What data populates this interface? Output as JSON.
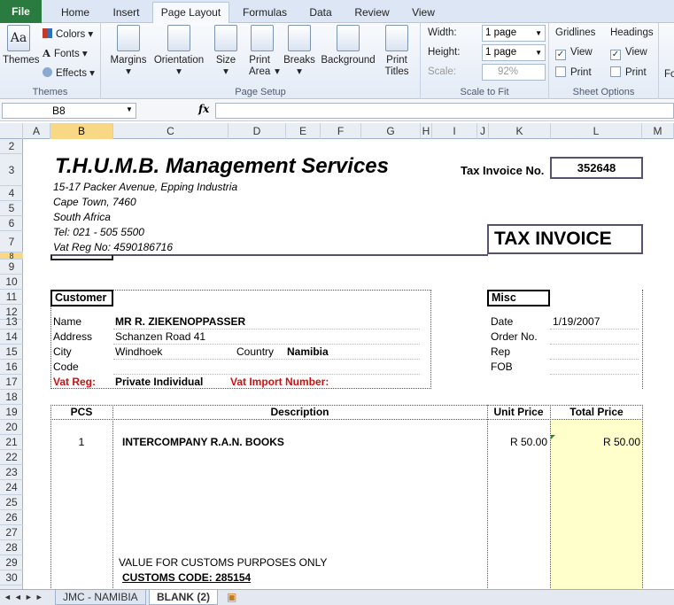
{
  "ribbon_tabs": {
    "file": "File",
    "home": "Home",
    "insert": "Insert",
    "page_layout": "Page Layout",
    "formulas": "Formulas",
    "data": "Data",
    "review": "Review",
    "view": "View"
  },
  "themes_group": {
    "themes": "Themes",
    "colors": "Colors",
    "fonts": "Fonts",
    "effects": "Effects",
    "label": "Themes"
  },
  "page_setup": {
    "margins": "Margins",
    "orientation": "Orientation",
    "size": "Size",
    "print_area": "Print Area",
    "breaks": "Breaks",
    "background": "Background",
    "print_titles": "Print Titles",
    "label": "Page Setup"
  },
  "scale_to_fit": {
    "width_label": "Width:",
    "width_value": "1 page",
    "height_label": "Height:",
    "height_value": "1 page",
    "scale_label": "Scale:",
    "scale_value": "92%",
    "label": "Scale to Fit"
  },
  "sheet_options": {
    "gridlines": "Gridlines",
    "headings": "Headings",
    "view": "View",
    "print": "Print",
    "label": "Sheet Options",
    "next_group": "Fo"
  },
  "formula_bar": {
    "name_box": "B8",
    "fx": "fx",
    "value": ""
  },
  "columns": [
    "A",
    "B",
    "C",
    "D",
    "E",
    "F",
    "G",
    "H",
    "I",
    "J",
    "K",
    "L",
    "M"
  ],
  "rows": [
    "2",
    "3",
    "4",
    "5",
    "6",
    "7",
    "8",
    "9",
    "10",
    "11",
    "12",
    "13",
    "14",
    "15",
    "16",
    "17",
    "18",
    "19",
    "20",
    "21",
    "22",
    "23",
    "24",
    "25",
    "26",
    "27",
    "28",
    "29",
    "30"
  ],
  "selected_cell": {
    "column": "B",
    "row": "8"
  },
  "invoice": {
    "company": "T.H.U.M.B. Management Services",
    "addr1": "15-17 Packer Avenue, Epping Industria",
    "addr2": "Cape Town, 7460",
    "addr3": "South Africa",
    "tel": "Tel:  021 - 505 5500",
    "vat": "Vat Reg No:  4590186716",
    "tax_invoice_no_label": "Tax Invoice No.",
    "tax_invoice_no": "352648",
    "title": "TAX INVOICE",
    "customer_label": "Customer",
    "name_label": "Name",
    "name_value": "MR R. ZIEKENOPPASSER",
    "address_label": "Address",
    "address_value": "Schanzen Road 41",
    "city_label": "City",
    "city_value": "Windhoek",
    "country_label": "Country",
    "country_value": "Namibia",
    "code_label": "Code",
    "vat_reg_label": "Vat Reg:",
    "vat_reg_value": "Private Individual",
    "vat_import_label": "Vat Import Number:",
    "misc_label": "Misc",
    "date_label": "Date",
    "date_value": "1/19/2007",
    "order_label": "Order No.",
    "rep_label": "Rep",
    "fob_label": "FOB",
    "pcs_header": "PCS",
    "desc_header": "Description",
    "unit_header": "Unit Price",
    "total_header": "Total Price",
    "line_pcs": "1",
    "line_desc": "INTERCOMPANY R.A.N. BOOKS",
    "line_unit": "R 50.00",
    "line_total": "R 50.00",
    "customs_note": "VALUE FOR CUSTOMS PURPOSES ONLY",
    "customs_code": "CUSTOMS CODE:  285154"
  },
  "sheet_tabs": [
    "JMC - NAMIBIA",
    "BLANK (2)"
  ],
  "colors": {
    "file_tab": "#2a7b3f",
    "selection": "#f8d885",
    "total_fill": "#ffffcc",
    "vat_red": "#d01010"
  }
}
